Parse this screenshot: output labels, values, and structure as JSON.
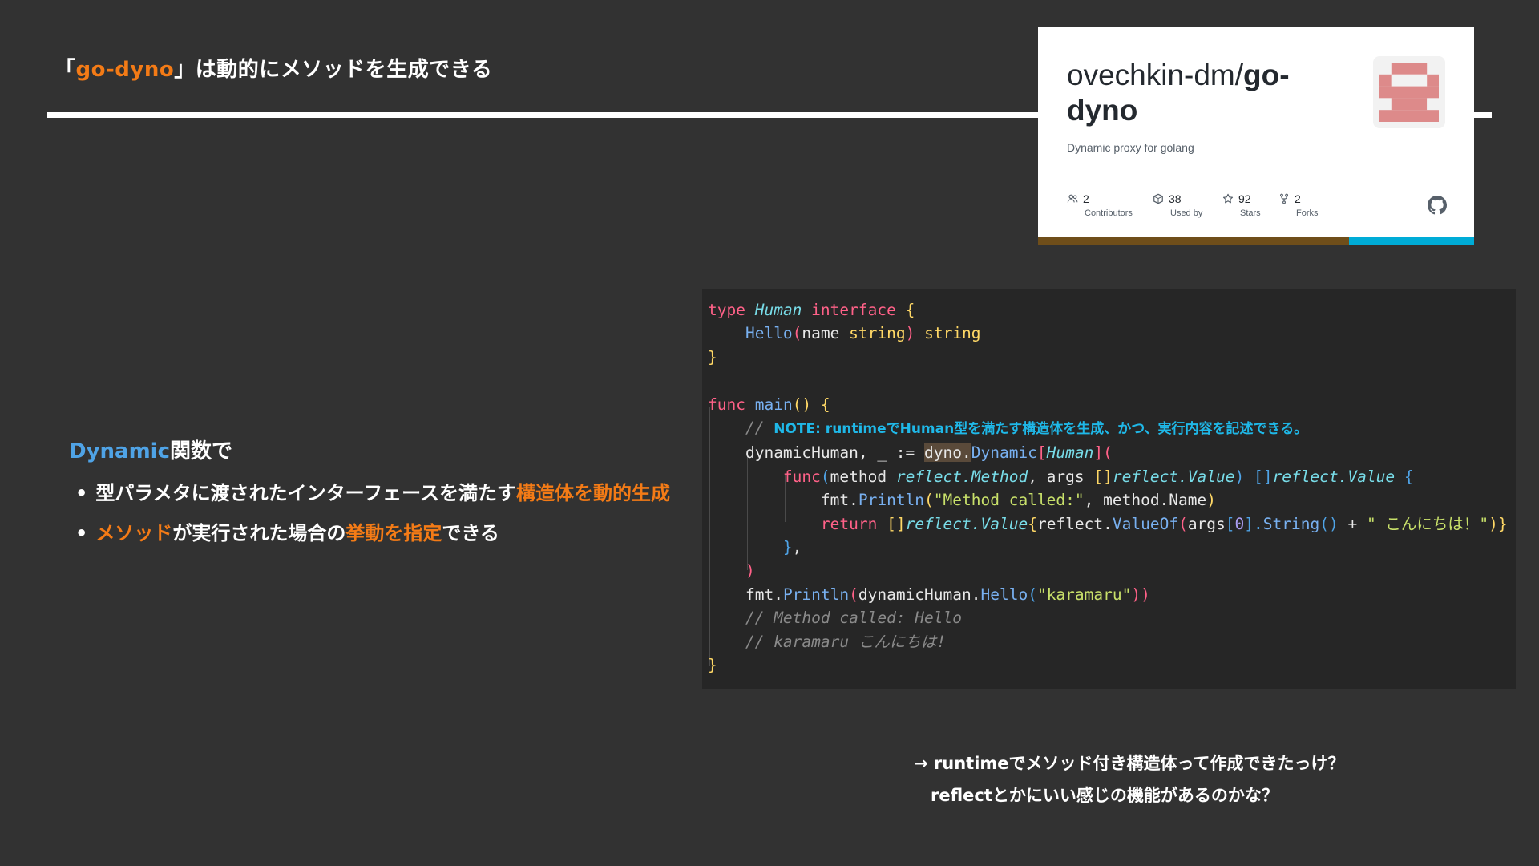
{
  "title": {
    "open": "「",
    "highlight": "go-dyno",
    "rest": "」は動的にメソッドを生成できる"
  },
  "github_card": {
    "owner": "ovechkin-dm/",
    "repo_line1": "go-",
    "repo_line2": "dyno",
    "description": "Dynamic proxy for golang",
    "stats": [
      {
        "value": "2",
        "label": "Contributors",
        "icon": "people-icon"
      },
      {
        "value": "38",
        "label": "Used by",
        "icon": "package-icon"
      },
      {
        "value": "92",
        "label": "Stars",
        "icon": "star-icon"
      },
      {
        "value": "2",
        "label": "Forks",
        "icon": "fork-icon"
      }
    ],
    "brand_colors": {
      "go": "#00acd7",
      "left_bar": "#6f4e1a"
    }
  },
  "lead": {
    "highlight": "Dynamic",
    "rest": "関数で"
  },
  "bullets": [
    {
      "pre": "型パラメタに渡されたインターフェースを満たす",
      "highlight": "構造体を動的生成",
      "post": ""
    },
    {
      "pre": "",
      "highlight": "メソッド",
      "mid": "が実行された場合の",
      "highlight2": "挙動を指定",
      "post": "できる"
    }
  ],
  "code": {
    "l1_kw": "type",
    "l1_ty": "Human",
    "l1_kw2": "interface",
    "l1_br": "{",
    "l2_fn": "Hello",
    "l2_a": "(",
    "l2_b": "name",
    "l2_c": "string",
    "l2_d": ")",
    "l2_e": "string",
    "l3": "}",
    "l5_kw": "func",
    "l5_fn": "main",
    "l5_p": "()",
    "l5_br": "{",
    "l6_cm": "// ",
    "l6_note": "NOTE: runtimeでHuman型を満たす構造体を生成、かつ、実行内容を記述できる。",
    "l7_a": "dynamicHuman, _ := ",
    "l7_b": "dyno.",
    "l7_c": "Dynamic",
    "l7_d": "[",
    "l7_e": "Human",
    "l7_f": "]",
    "l7_g": "(",
    "l8_kw": "func",
    "l8_a": "(",
    "l8_b": "method ",
    "l8_c": "reflect.Method",
    "l8_d": ", args ",
    "l8_e": "[]",
    "l8_f": "reflect.Value",
    "l8_g": ") ",
    "l8_h": "[]",
    "l8_i": "reflect.Value",
    "l8_j": " {",
    "l9_a": "fmt.",
    "l9_b": "Println",
    "l9_c": "(",
    "l9_d": "\"Method called:\"",
    "l9_e": ", method.Name",
    "l9_f": ")",
    "l10_kw": "return",
    "l10_a": " []",
    "l10_b": "reflect.Value",
    "l10_c": "{",
    "l10_d": "reflect.",
    "l10_e": "ValueOf",
    "l10_f": "(",
    "l10_g": "args",
    "l10_h": "[",
    "l10_i": "0",
    "l10_j": "].",
    "l10_k": "String",
    "l10_l": "()",
    "l10_m": " + ",
    "l10_n": "\" こんにちは！\"",
    "l10_o": ")}",
    "l11_a": "}",
    "l11_b": ",",
    "l12": ")",
    "l13_a": "fmt.",
    "l13_b": "Println",
    "l13_c": "(",
    "l13_d": "dynamicHuman.",
    "l13_e": "Hello",
    "l13_f": "(",
    "l13_g": "\"karamaru\"",
    "l13_h": "))",
    "l14": "// Method called: Hello",
    "l15": "// karamaru こんにちは!",
    "l16": "}"
  },
  "footer": {
    "line1_arrow": "→",
    "line1": "runtimeでメソッド付き構造体って作成できたっけ？",
    "line2": "reflectとかにいい感じの機能があるのかな？"
  }
}
